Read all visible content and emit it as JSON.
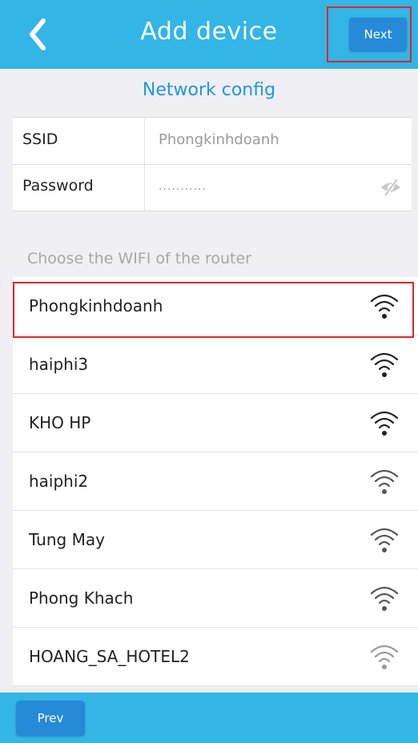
{
  "header": {
    "title": "Add device",
    "back_icon": "chevron-left-icon",
    "next_label": "Next"
  },
  "network_config": {
    "section_title": "Network config",
    "ssid_label": "SSID",
    "ssid_value": "Phongkinhdoanh",
    "password_label": "Password",
    "password_value": "···········",
    "visibility_icon": "eye-slash-icon"
  },
  "wifi": {
    "prompt": "Choose the WIFI of the router",
    "networks": [
      {
        "name": "Phongkinhdoanh",
        "signal": 4,
        "selected": true
      },
      {
        "name": "haiphi3",
        "signal": 4
      },
      {
        "name": "KHO HP",
        "signal": 4
      },
      {
        "name": "haiphi2",
        "signal": 3
      },
      {
        "name": "Tung May",
        "signal": 3
      },
      {
        "name": "Phong Khach",
        "signal": 3
      },
      {
        "name": "HOANG_SA_HOTEL2",
        "signal": 2
      }
    ]
  },
  "footer": {
    "prev_label": "Prev"
  },
  "colors": {
    "header_bg": "#33b5e5",
    "button_bg": "#268ad8",
    "accent_text": "#2196e0",
    "highlight": "#e0262a"
  }
}
